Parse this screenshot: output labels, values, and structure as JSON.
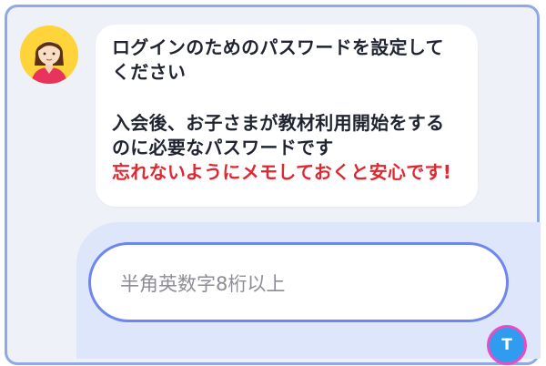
{
  "chat": {
    "bot_message": {
      "line1": "ログインのためのパスワードを設定して",
      "line2": "ください",
      "line3": "入会後、お子さまが教材利用開始をする",
      "line4": "のに必要なパスワードです",
      "warning": "忘れないようにメモしておくと安心です!"
    }
  },
  "password_input": {
    "placeholder": "半角英数字8桁以上",
    "value": ""
  },
  "user": {
    "initial": "T"
  },
  "colors": {
    "warning_text": "#e0262f",
    "input_border": "#6f86ee",
    "input_area_bg": "#dde6fb",
    "avatar_bg": "#ffd43b",
    "user_avatar_bg": "#2f9cf0"
  }
}
